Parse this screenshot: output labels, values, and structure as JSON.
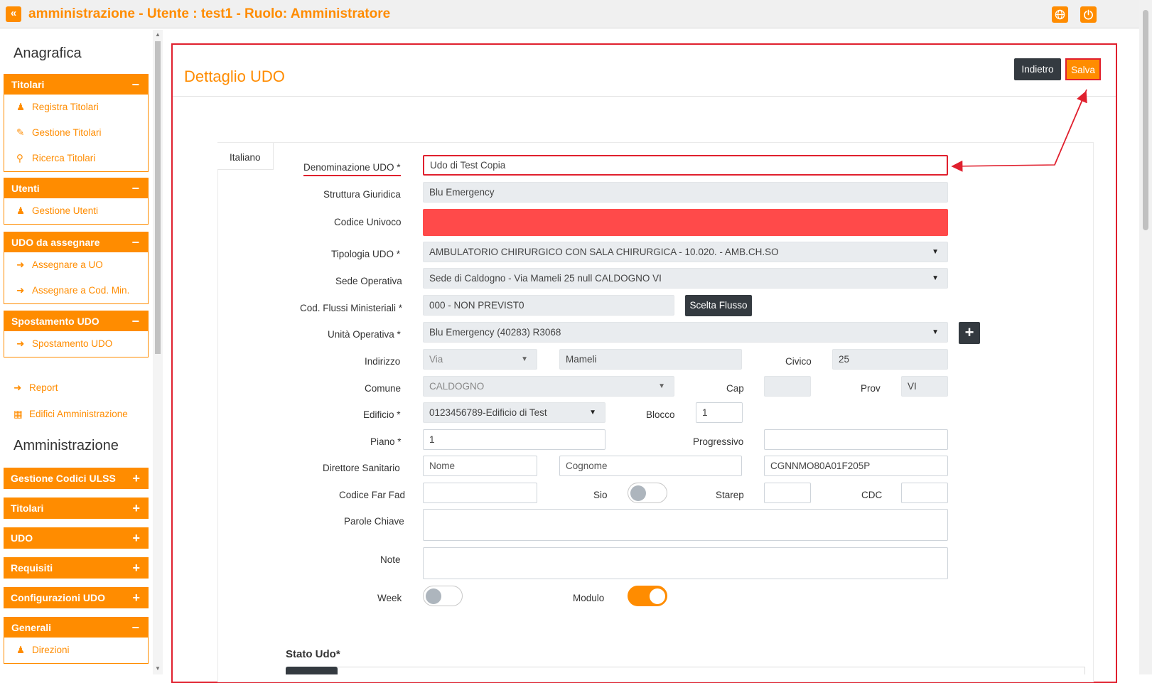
{
  "header": {
    "back_icon": "double-chevron-left-icon",
    "title": "amministrazione - Utente : test1 - Ruolo: Amministratore",
    "globe_icon": "globe-icon",
    "power_icon": "power-icon"
  },
  "sidebar": {
    "heading_anagrafica": "Anagrafica",
    "heading_amministrazione": "Amministrazione",
    "titolari": {
      "title": "Titolari",
      "sign": "−",
      "items": [
        "Registra Titolari",
        "Gestione Titolari",
        "Ricerca Titolari"
      ]
    },
    "utenti": {
      "title": "Utenti",
      "sign": "−",
      "items": [
        "Gestione Utenti"
      ]
    },
    "udo_assegnare": {
      "title": "UDO da assegnare",
      "sign": "−",
      "items": [
        "Assegnare a UO",
        "Assegnare a Cod. Min."
      ]
    },
    "spostamento": {
      "title": "Spostamento UDO",
      "sign": "−",
      "items": [
        "Spostamento UDO"
      ]
    },
    "links": [
      "Report",
      "Edifici Amministrazione"
    ],
    "admin_sections": [
      "Gestione Codici ULSS",
      "Titolari",
      "UDO",
      "Requisiti",
      "Configurazioni UDO"
    ],
    "plus": "+",
    "generali": {
      "title": "Generali",
      "sign": "−",
      "items": [
        "Direzioni"
      ]
    }
  },
  "main": {
    "title": "Dettaglio UDO",
    "back_button": "Indietro",
    "save_button": "Salva",
    "tab": "Italiano",
    "labels": {
      "denominazione": "Denominazione UDO *",
      "struttura": "Struttura Giuridica",
      "codice": "Codice Univoco",
      "tipologia": "Tipologia UDO *",
      "sede": "Sede Operativa",
      "flussi": "Cod. Flussi Ministeriali *",
      "unita": "Unità Operativa *",
      "indirizzo": "Indirizzo",
      "civico": "Civico",
      "comune": "Comune",
      "cap": "Cap",
      "prov": "Prov",
      "edificio": "Edificio *",
      "blocco": "Blocco",
      "piano": "Piano *",
      "progressivo": "Progressivo",
      "direttore": "Direttore Sanitario",
      "codice_far_fad": "Codice Far Fad",
      "sio": "Sio",
      "starep": "Starep",
      "cdc": "CDC",
      "parole": "Parole Chiave",
      "note": "Note",
      "week": "Week",
      "modulo": "Modulo",
      "stato": "Stato Udo*"
    },
    "values": {
      "denominazione": "Udo di Test Copia",
      "struttura": "Blu Emergency",
      "codice": "",
      "tipologia": "AMBULATORIO CHIRURGICO CON SALA CHIRURGICA - 10.020. - AMB.CH.SO",
      "sede": "Sede di Caldogno - Via Mameli 25 null CALDOGNO VI",
      "flussi": "000 - NON PREVIST0",
      "scelta_flusso": "Scelta Flusso",
      "unita": "Blu Emergency (40283) R3068",
      "add": "+",
      "via": "Via",
      "strada": "Mameli",
      "civico": "25",
      "comune": "CALDOGNO",
      "cap": "",
      "prov": "VI",
      "edificio": "0123456789-Edificio di Test",
      "blocco": "1",
      "piano": "1",
      "progressivo": "",
      "nome_placeholder": "Nome",
      "cognome_placeholder": "Cognome",
      "cf": "CGNNMO80A01F205P",
      "codice_far_fad": "",
      "starep": "",
      "cdc": "",
      "sio_on": false,
      "week_on": false,
      "modulo_on": true
    }
  },
  "colors": {
    "accent": "#ff8c00",
    "highlight": "#e0202e",
    "error_field": "#ff4a4a",
    "dark_button": "#343a40"
  }
}
